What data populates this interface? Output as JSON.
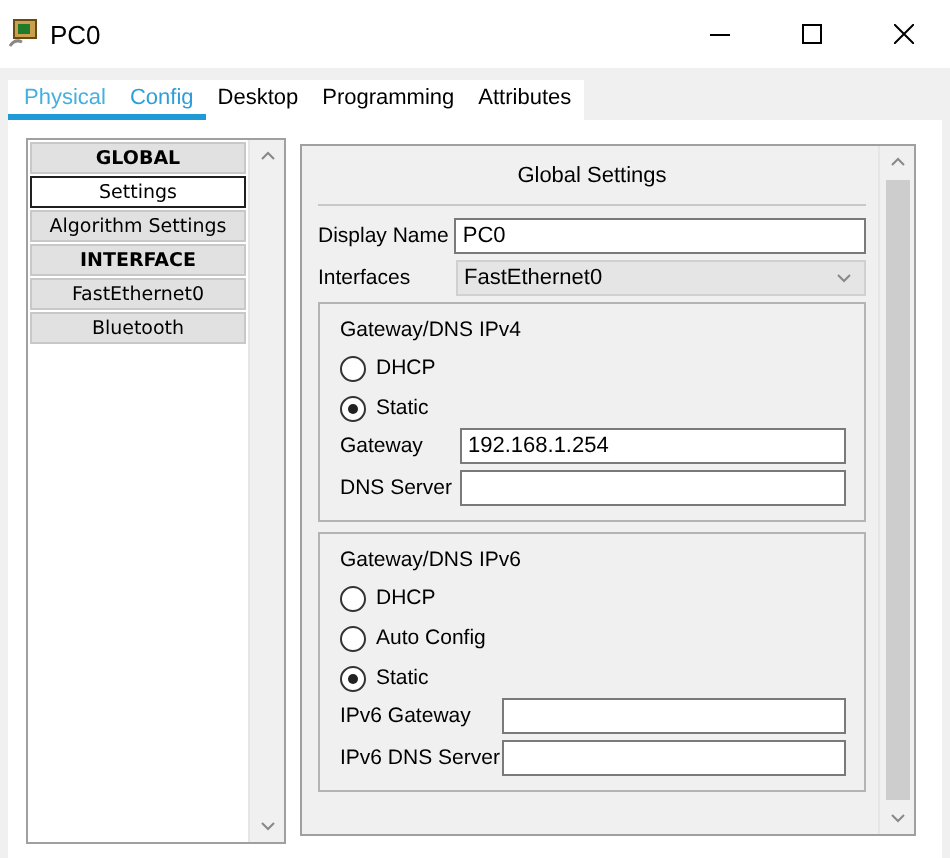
{
  "window": {
    "title": "PC0"
  },
  "tabs": [
    {
      "label": "Physical",
      "selected": false
    },
    {
      "label": "Config",
      "selected": true
    },
    {
      "label": "Desktop",
      "selected": false
    },
    {
      "label": "Programming",
      "selected": false
    },
    {
      "label": "Attributes",
      "selected": false
    }
  ],
  "sidebar": {
    "items": [
      {
        "label": "GLOBAL",
        "kind": "header",
        "selected": false
      },
      {
        "label": "Settings",
        "kind": "item",
        "selected": true
      },
      {
        "label": "Algorithm Settings",
        "kind": "item",
        "selected": false
      },
      {
        "label": "INTERFACE",
        "kind": "header",
        "selected": false
      },
      {
        "label": "FastEthernet0",
        "kind": "item",
        "selected": false
      },
      {
        "label": "Bluetooth",
        "kind": "item",
        "selected": false
      }
    ]
  },
  "panel": {
    "title": "Global Settings",
    "display_name": {
      "label": "Display Name",
      "value": "PC0"
    },
    "interfaces": {
      "label": "Interfaces",
      "value": "FastEthernet0"
    },
    "groups": [
      {
        "title": "Gateway/DNS IPv4",
        "options": [
          {
            "label": "DHCP",
            "selected": false
          },
          {
            "label": "Static",
            "selected": true
          }
        ],
        "fields": [
          {
            "label": "Gateway",
            "value": "192.168.1.254"
          },
          {
            "label": "DNS Server"
          }
        ]
      },
      {
        "title": "Gateway/DNS IPv6",
        "options": [
          {
            "label": "DHCP",
            "selected": false
          },
          {
            "label": "Auto Config",
            "selected": false
          },
          {
            "label": "Static",
            "selected": true
          }
        ],
        "fields": [
          {
            "label": "IPv6 Gateway"
          },
          {
            "label": "IPv6 DNS Server"
          }
        ]
      }
    ]
  }
}
